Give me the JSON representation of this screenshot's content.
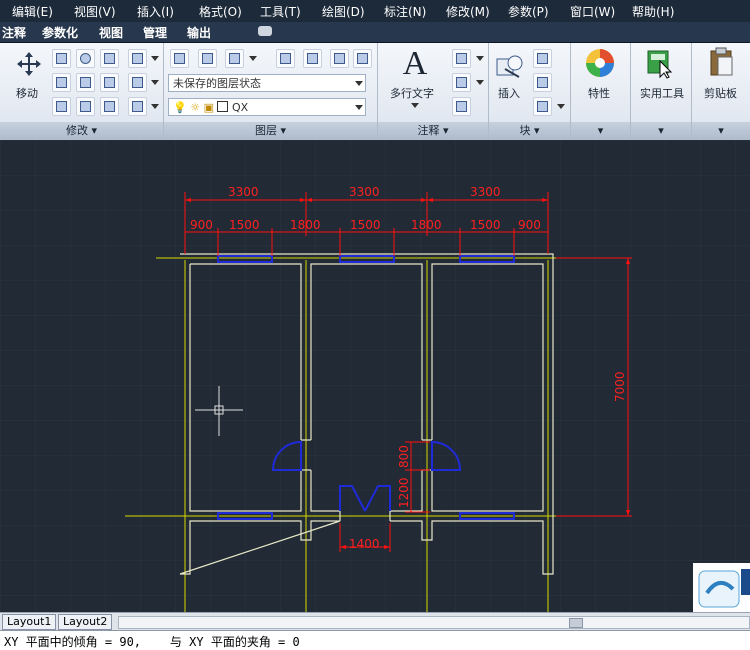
{
  "menu": [
    "编辑(E)",
    "视图(V)",
    "插入(I)",
    "格式(O)",
    "工具(T)",
    "绘图(D)",
    "标注(N)",
    "修改(M)",
    "参数(P)",
    "窗口(W)",
    "帮助(H)"
  ],
  "ribbon_tabs": [
    "注释",
    "参数化",
    "视图",
    "管理",
    "输出"
  ],
  "panels": {
    "modify": {
      "title": "修改",
      "move_label": "移动"
    },
    "layers": {
      "title": "图层",
      "layer_state": "未保存的图层状态",
      "current_layer": "QX"
    },
    "annotation": {
      "title": "注释",
      "mtext_label": "多行文字"
    },
    "block": {
      "title": "块",
      "insert_label": "插入"
    },
    "properties_label": "特性",
    "utilities_label": "实用工具",
    "clipboard_label": "剪贴板"
  },
  "drawing": {
    "dim_top_overall": [
      "3300",
      "3300",
      "3300"
    ],
    "dim_top_detail": [
      "900",
      "1500",
      "1800",
      "1500",
      "1800",
      "1500",
      "900"
    ],
    "dim_height": "7000",
    "dim_door_width": "1400",
    "dim_vertical_small": [
      "1200",
      "800"
    ],
    "colors": {
      "background": "#212a35",
      "wall": "#e8e8c8",
      "axis": "#d8d800",
      "dim": "#ff1010",
      "window": "#1f2ad8",
      "door": "#1f2ad8"
    }
  },
  "layout_tabs": [
    "Layout1",
    "Layout2"
  ],
  "command_line": "XY 平面中的倾角 = 90,    与 XY 平面的夹角 = 0"
}
